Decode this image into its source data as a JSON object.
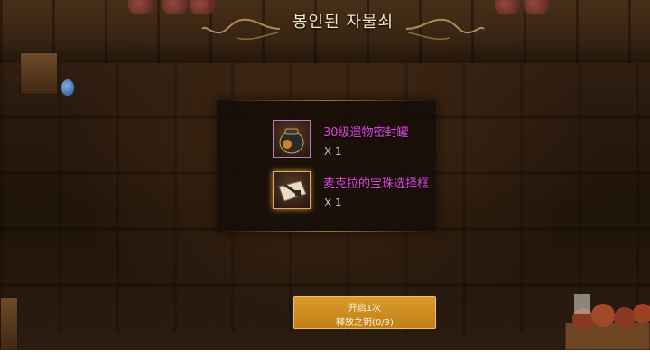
{
  "title": "봉인된 자물쇠",
  "rewards": [
    {
      "name": "30级遗物密封罐",
      "qty": "X 1",
      "icon": "sealed-jar-icon",
      "name_color": "#e04ae0"
    },
    {
      "name": "麦克拉的宝珠选择框",
      "qty": "X 1",
      "icon": "selection-box-icon",
      "name_color": "#e04ae0"
    }
  ],
  "open_button": {
    "line1": "开启1次",
    "line2": "释放之钥(0/3)",
    "color": "#c98a1f"
  }
}
